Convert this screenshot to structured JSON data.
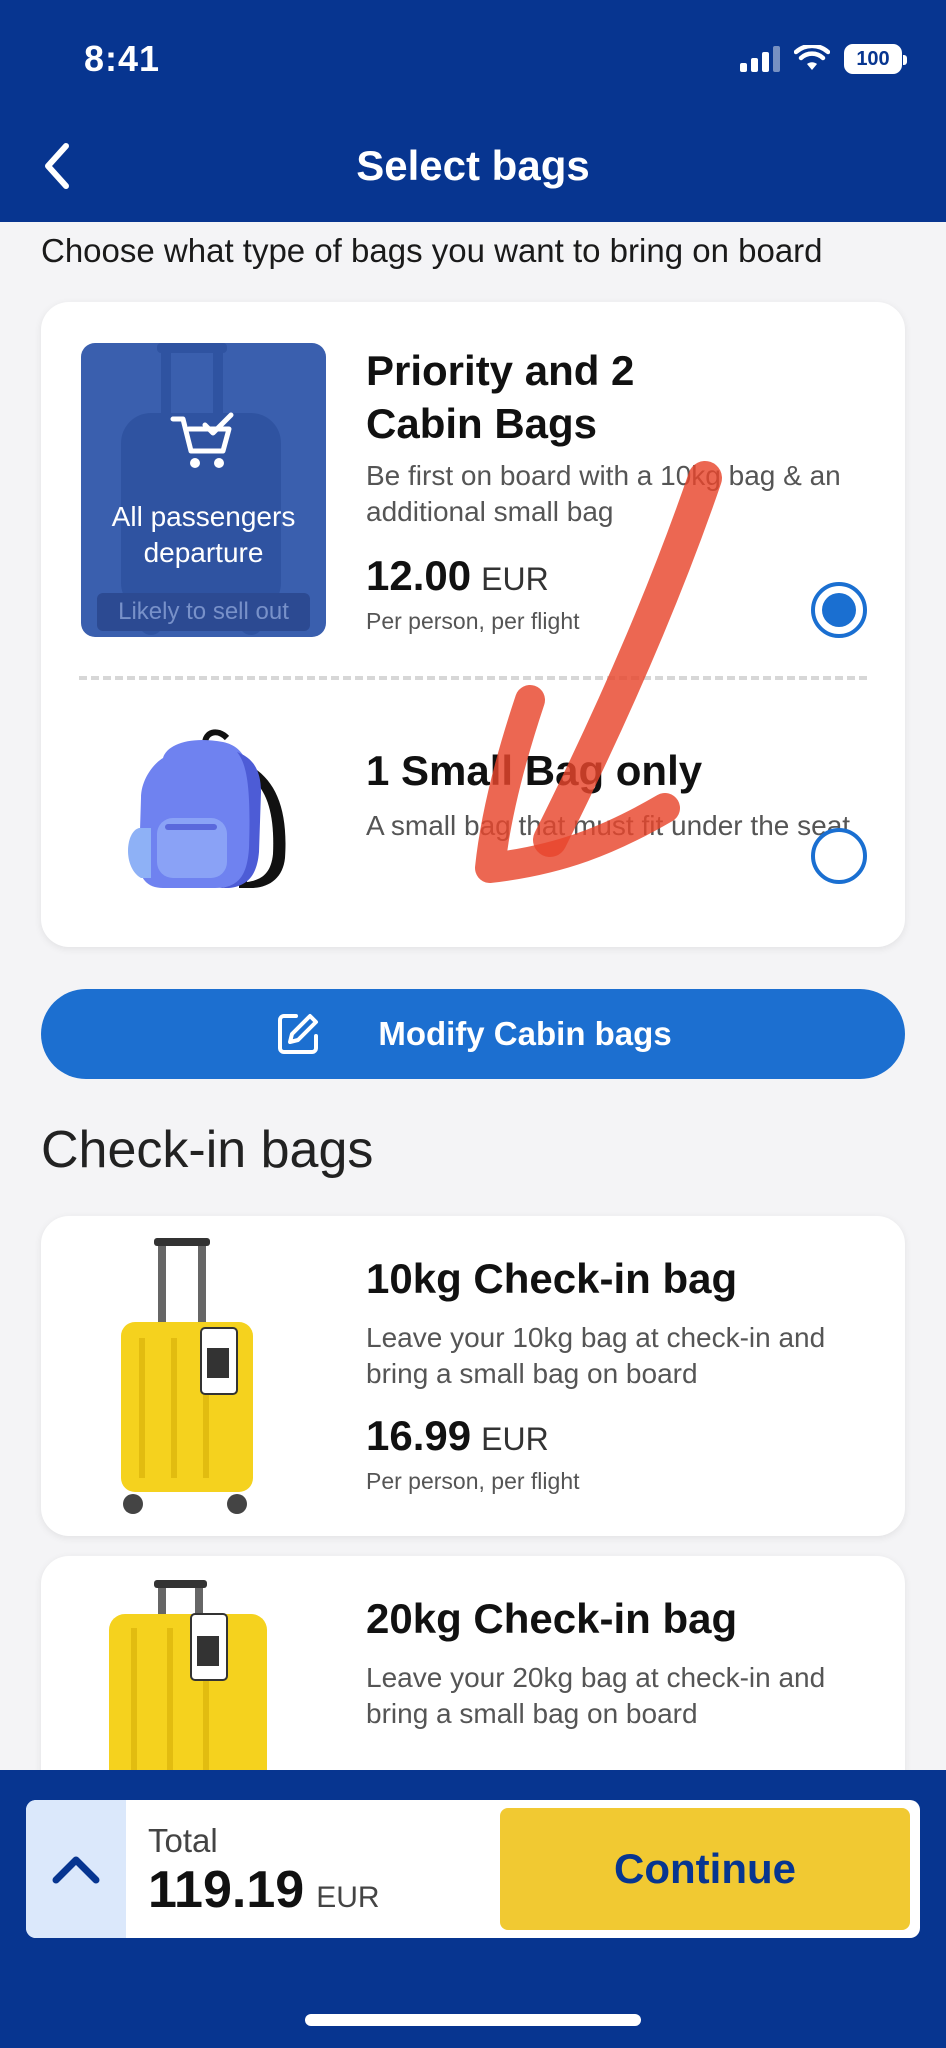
{
  "status_bar": {
    "time": "8:41",
    "battery": "100"
  },
  "header": {
    "title": "Select bags"
  },
  "subtitle": "Choose what type of bags you want to bring on board",
  "cabin_options": [
    {
      "title_line1": "Priority and 2",
      "title_line2": "Cabin Bags",
      "description": "Be first on board with a 10kg bag & an additional small bag",
      "price": "12.00",
      "currency": "EUR",
      "per_person": "Per person, per flight",
      "promo_text_line1": "All passengers",
      "promo_text_line2": "departure",
      "promo_badge": "Likely to sell out",
      "selected": true
    },
    {
      "title": "1 Small Bag only",
      "description": "A small bag that must fit under the seat",
      "selected": false
    }
  ],
  "modify_button": "Modify Cabin bags",
  "checkin_section_title": "Check-in bags",
  "checkin_options": [
    {
      "title": "10kg Check-in bag",
      "description": "Leave your 10kg bag at check-in and bring a small bag on board",
      "price": "16.99",
      "currency": "EUR",
      "per_person": "Per person, per flight"
    },
    {
      "title": "20kg Check-in bag",
      "description": "Leave your 20kg bag at check-in and bring a small bag on board"
    }
  ],
  "bottom_bar": {
    "total_label": "Total",
    "total_value": "119.19",
    "currency": "EUR",
    "continue_label": "Continue"
  },
  "colors": {
    "brand_blue": "#073590",
    "accent_blue": "#1c6fd0",
    "continue_yellow": "#f1c932",
    "annotation_red": "#e8452c"
  }
}
